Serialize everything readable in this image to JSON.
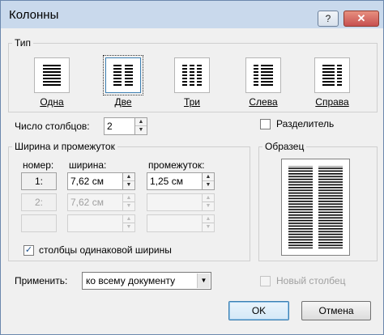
{
  "window": {
    "title": "Колонны",
    "help_glyph": "?",
    "close_glyph": "✕"
  },
  "type_group": {
    "title": "Тип",
    "presets": [
      {
        "key": "one",
        "label": "Одна",
        "selected": false
      },
      {
        "key": "two",
        "label": "Две",
        "selected": true
      },
      {
        "key": "three",
        "label": "Три",
        "selected": false
      },
      {
        "key": "left",
        "label": "Слева",
        "selected": false
      },
      {
        "key": "right",
        "label": "Справа",
        "selected": false
      }
    ]
  },
  "num_columns": {
    "label": "Число столбцов:",
    "value": "2"
  },
  "separator": {
    "label": "Разделитель",
    "checked": false
  },
  "width_spacing": {
    "title": "Ширина и промежуток",
    "col_header": "номер:",
    "width_header": "ширина:",
    "spacing_header": "промежуток:",
    "rows": [
      {
        "num": "1:",
        "width": "7,62 см",
        "spacing": "1,25 см",
        "enabled": true
      },
      {
        "num": "2:",
        "width": "7,62 см",
        "spacing": "",
        "enabled": false
      },
      {
        "num": "",
        "width": "",
        "spacing": "",
        "enabled": false
      }
    ],
    "equal_width_label": "столбцы одинаковой ширины",
    "equal_width_checked": true
  },
  "sample": {
    "title": "Образец"
  },
  "apply": {
    "label": "Применить:",
    "value": "ко всему документу"
  },
  "new_column": {
    "label": "Новый столбец",
    "checked": false,
    "enabled": false
  },
  "buttons": {
    "ok": "OK",
    "cancel": "Отмена"
  },
  "colors": {
    "title_bar": "#c9d9ec",
    "close_button": "#c75050",
    "selection_border": "#3c7fb1"
  }
}
